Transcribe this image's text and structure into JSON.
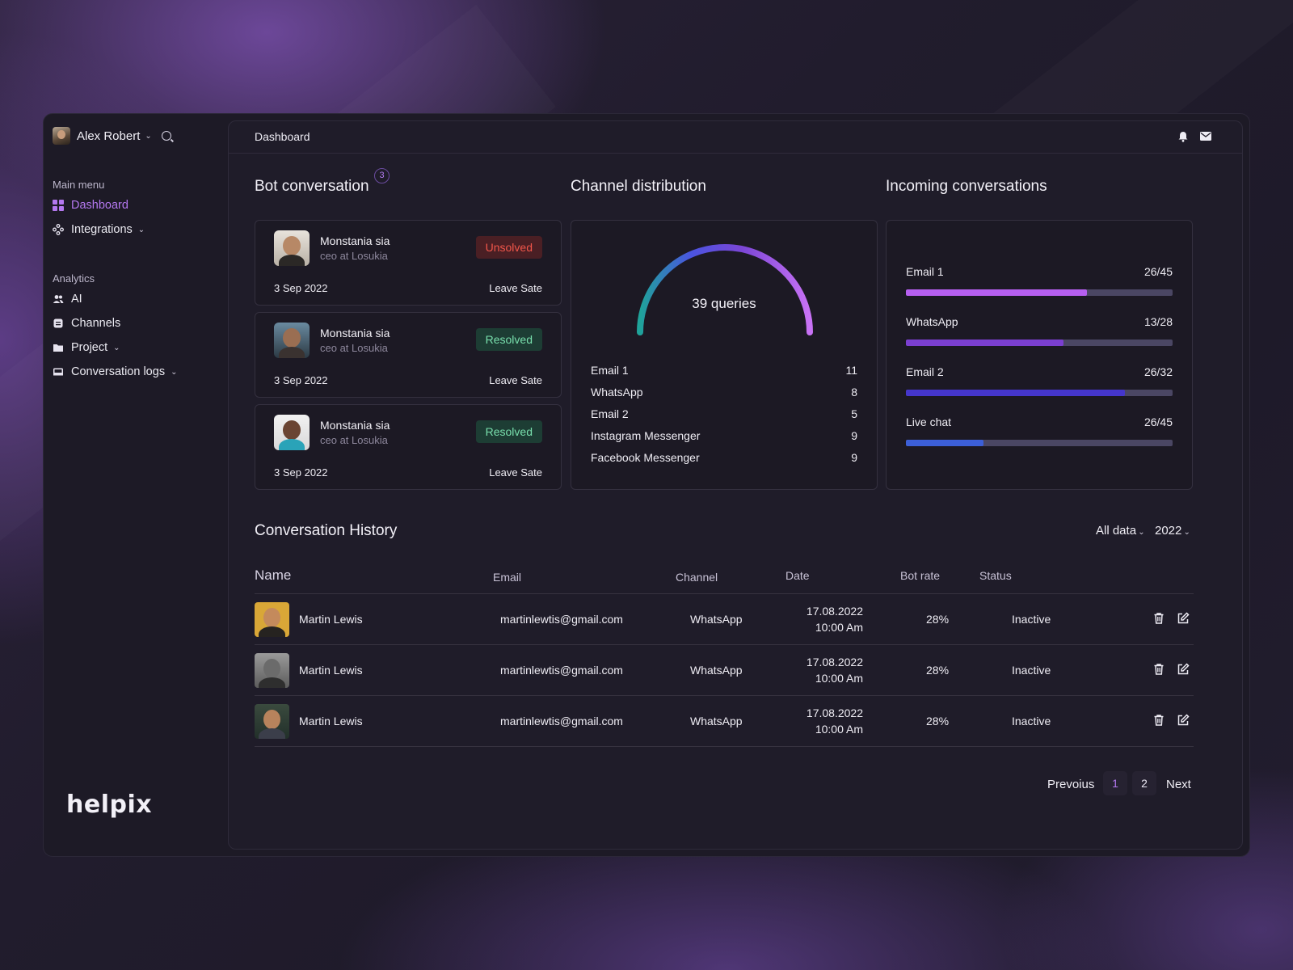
{
  "sidebar": {
    "user_name": "Alex Robert",
    "main_menu_label": "Main menu",
    "main_menu": [
      {
        "label": "Dashboard",
        "icon": "dashboard-grid-icon",
        "active": true
      },
      {
        "label": "Integrations",
        "icon": "integrations-icon",
        "has_caret": true
      }
    ],
    "analytics_label": "Analytics",
    "analytics": [
      {
        "label": "AI",
        "icon": "users-icon"
      },
      {
        "label": "Channels",
        "icon": "channels-icon"
      },
      {
        "label": "Project",
        "icon": "folder-icon",
        "has_caret": true
      },
      {
        "label": "Conversation logs",
        "icon": "inbox-icon",
        "has_caret": true
      }
    ],
    "brand": "helpix"
  },
  "topbar": {
    "title": "Dashboard"
  },
  "bot_conversation": {
    "title": "Bot conversation",
    "badge": "3",
    "items": [
      {
        "name": "Monstania sia",
        "role": "ceo at Losukia",
        "status": "Unsolved",
        "date": "3 Sep 2022",
        "action": "Leave Sate"
      },
      {
        "name": "Monstania sia",
        "role": "ceo at Losukia",
        "status": "Resolved",
        "date": "3 Sep 2022",
        "action": "Leave Sate"
      },
      {
        "name": "Monstania sia",
        "role": "ceo at Losukia",
        "status": "Resolved",
        "date": "3 Sep 2022",
        "action": "Leave Sate"
      }
    ]
  },
  "channel_distribution": {
    "title": "Channel distribution",
    "gauge_label": "39 queries",
    "gauge_colors": [
      "#1fa39a",
      "#4a54e0",
      "#7b46d6",
      "#c872f5"
    ],
    "rows": [
      {
        "label": "Email 1",
        "value": "11"
      },
      {
        "label": "WhatsApp",
        "value": "8"
      },
      {
        "label": "Email 2",
        "value": "5"
      },
      {
        "label": "Instagram Messenger",
        "value": "9"
      },
      {
        "label": "Facebook Messenger",
        "value": "9"
      }
    ]
  },
  "incoming": {
    "title": "Incoming conversations",
    "rows": [
      {
        "label": "Email 1",
        "value": "26/45",
        "fraction": 0.68,
        "color": "#b65ff0"
      },
      {
        "label": "WhatsApp",
        "value": "13/28",
        "fraction": 0.59,
        "color": "#7b3fd0"
      },
      {
        "label": "Email 2",
        "value": "26/32",
        "fraction": 0.82,
        "color": "#4536cc"
      },
      {
        "label": "Live chat",
        "value": "26/45",
        "fraction": 0.29,
        "color": "#3c5fd8"
      }
    ]
  },
  "history": {
    "title": "Conversation History",
    "filter_label": "All data",
    "year": "2022",
    "columns": [
      "Name",
      "Email",
      "Channel",
      "Date",
      "Bot rate",
      "Status"
    ],
    "rows": [
      {
        "name": "Martin Lewis",
        "email": "martinlewtis@gmail.com",
        "channel": "WhatsApp",
        "date": "17.08.2022",
        "time": "10:00 Am",
        "bot_rate": "28%",
        "status": "Inactive"
      },
      {
        "name": "Martin Lewis",
        "email": "martinlewtis@gmail.com",
        "channel": "WhatsApp",
        "date": "17.08.2022",
        "time": "10:00 Am",
        "bot_rate": "28%",
        "status": "Inactive"
      },
      {
        "name": "Martin Lewis",
        "email": "martinlewtis@gmail.com",
        "channel": "WhatsApp",
        "date": "17.08.2022",
        "time": "10:00 Am",
        "bot_rate": "28%",
        "status": "Inactive"
      }
    ],
    "row_actions": [
      "trash-icon",
      "edit-icon"
    ]
  },
  "pagination": {
    "previous": "Prevoius",
    "pages": [
      "1",
      "2"
    ],
    "current": "1",
    "next": "Next"
  },
  "colors": {
    "accent": "#b478f0",
    "unsolved": "#f2564a",
    "resolved": "#79e0ad"
  }
}
